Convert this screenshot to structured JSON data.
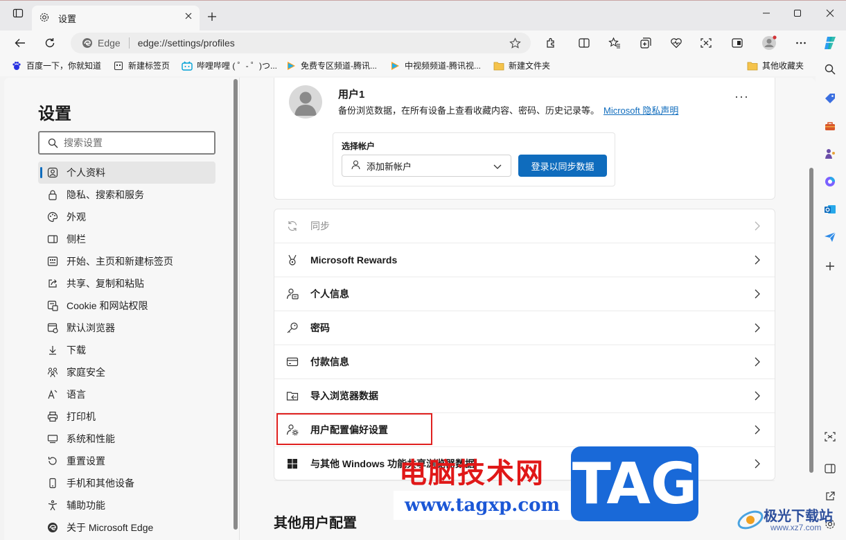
{
  "window": {
    "tab_title": "设置",
    "address_chip": "Edge",
    "url": "edge://settings/profiles"
  },
  "bookmarks": [
    {
      "label": "百度一下，你就知道",
      "icon": "baidu-icon"
    },
    {
      "label": "新建标签页",
      "icon": "new-tab-page-icon"
    },
    {
      "label": "哔哩哔哩 ( ゜- ゜)つ...",
      "icon": "bilibili-icon"
    },
    {
      "label": "免费专区频道-腾讯...",
      "icon": "tencent-video-icon"
    },
    {
      "label": "中视频频道-腾讯视...",
      "icon": "tencent-video-icon"
    },
    {
      "label": "新建文件夹",
      "icon": "folder-icon"
    }
  ],
  "bookmarks_other": "其他收藏夹",
  "sidebar": {
    "title": "设置",
    "search_placeholder": "搜索设置",
    "items": [
      {
        "label": "个人资料",
        "icon": "profile-icon",
        "active": true
      },
      {
        "label": "隐私、搜索和服务",
        "icon": "lock-icon"
      },
      {
        "label": "外观",
        "icon": "palette-icon"
      },
      {
        "label": "侧栏",
        "icon": "sidebar-icon"
      },
      {
        "label": "开始、主页和新建标签页",
        "icon": "home-icon"
      },
      {
        "label": "共享、复制和粘贴",
        "icon": "share-icon"
      },
      {
        "label": "Cookie 和网站权限",
        "icon": "cookie-icon"
      },
      {
        "label": "默认浏览器",
        "icon": "browser-icon"
      },
      {
        "label": "下载",
        "icon": "download-icon"
      },
      {
        "label": "家庭安全",
        "icon": "family-icon"
      },
      {
        "label": "语言",
        "icon": "language-icon"
      },
      {
        "label": "打印机",
        "icon": "printer-icon"
      },
      {
        "label": "系统和性能",
        "icon": "system-icon"
      },
      {
        "label": "重置设置",
        "icon": "reset-icon"
      },
      {
        "label": "手机和其他设备",
        "icon": "phone-icon"
      },
      {
        "label": "辅助功能",
        "icon": "accessibility-icon"
      },
      {
        "label": "关于 Microsoft Edge",
        "icon": "edge-icon"
      }
    ]
  },
  "profile": {
    "name": "用户1",
    "description": "备份浏览数据，在所有设备上查看收藏内容、密码、历史记录等。",
    "privacy_link": "Microsoft 隐私声明",
    "more": "···",
    "account_label": "选择帐户",
    "account_value": "添加新帐户",
    "sync_button": "登录以同步数据"
  },
  "settings_rows": [
    {
      "label": "同步",
      "icon": "sync-icon",
      "disabled": true
    },
    {
      "label": "Microsoft Rewards",
      "icon": "rewards-icon"
    },
    {
      "label": "个人信息",
      "icon": "personal-info-icon"
    },
    {
      "label": "密码",
      "icon": "key-icon"
    },
    {
      "label": "付款信息",
      "icon": "card-icon"
    },
    {
      "label": "导入浏览器数据",
      "icon": "import-icon"
    },
    {
      "label": "用户配置偏好设置",
      "icon": "profile-settings-icon"
    },
    {
      "label": "与其他 Windows 功能共享浏览器数据",
      "icon": "windows-icon"
    }
  ],
  "other_profiles_title": "其他用户配置",
  "watermark": {
    "cn": "电脑技术网",
    "url": "www.tagxp.com",
    "tag": "TAG",
    "site_name": "极光下载站",
    "site_url": "www.xz7.com"
  },
  "colors": {
    "accent": "#0f6cbd",
    "highlight": "#e0201f"
  }
}
